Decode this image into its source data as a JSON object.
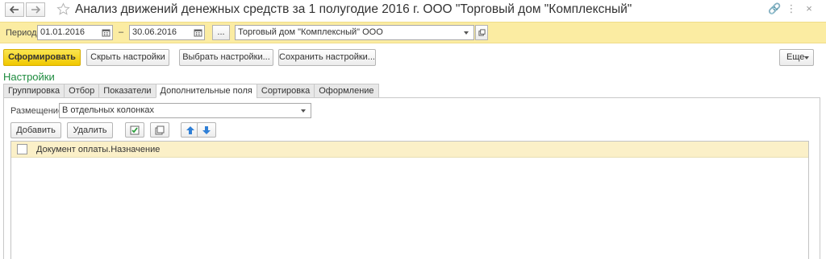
{
  "window": {
    "title": "Анализ движений денежных средств за 1 полугодие 2016 г. ООО \"Торговый дом \"Комплексный\""
  },
  "period_bar": {
    "period_label": "Период:",
    "date_from": "01.01.2016",
    "dash": "–",
    "date_to": "30.06.2016",
    "more_button": "...",
    "organization": "Торговый дом \"Комплексный\" ООО"
  },
  "toolbar": {
    "generate": "Сформировать",
    "hide_settings": "Скрыть настройки",
    "select_settings": "Выбрать настройки...",
    "save_settings": "Сохранить настройки...",
    "more": "Еще"
  },
  "settings": {
    "title": "Настройки",
    "tabs": [
      {
        "label": "Группировка"
      },
      {
        "label": "Отбор"
      },
      {
        "label": "Показатели"
      },
      {
        "label": "Дополнительные поля"
      },
      {
        "label": "Сортировка"
      },
      {
        "label": "Оформление"
      }
    ],
    "placement_label": "Размещение:",
    "placement_value": "В отдельных колонках",
    "add": "Добавить",
    "delete": "Удалить",
    "rows": [
      {
        "text": "Документ оплаты.Назначение",
        "checked": false
      }
    ]
  },
  "colors": {
    "accent_bar": "#fbeca2",
    "primary_button": "#f5d419",
    "section_title": "#1d8b3e",
    "selected_row": "#fbf0c8",
    "arrow_blue": "#2f7fd6"
  }
}
